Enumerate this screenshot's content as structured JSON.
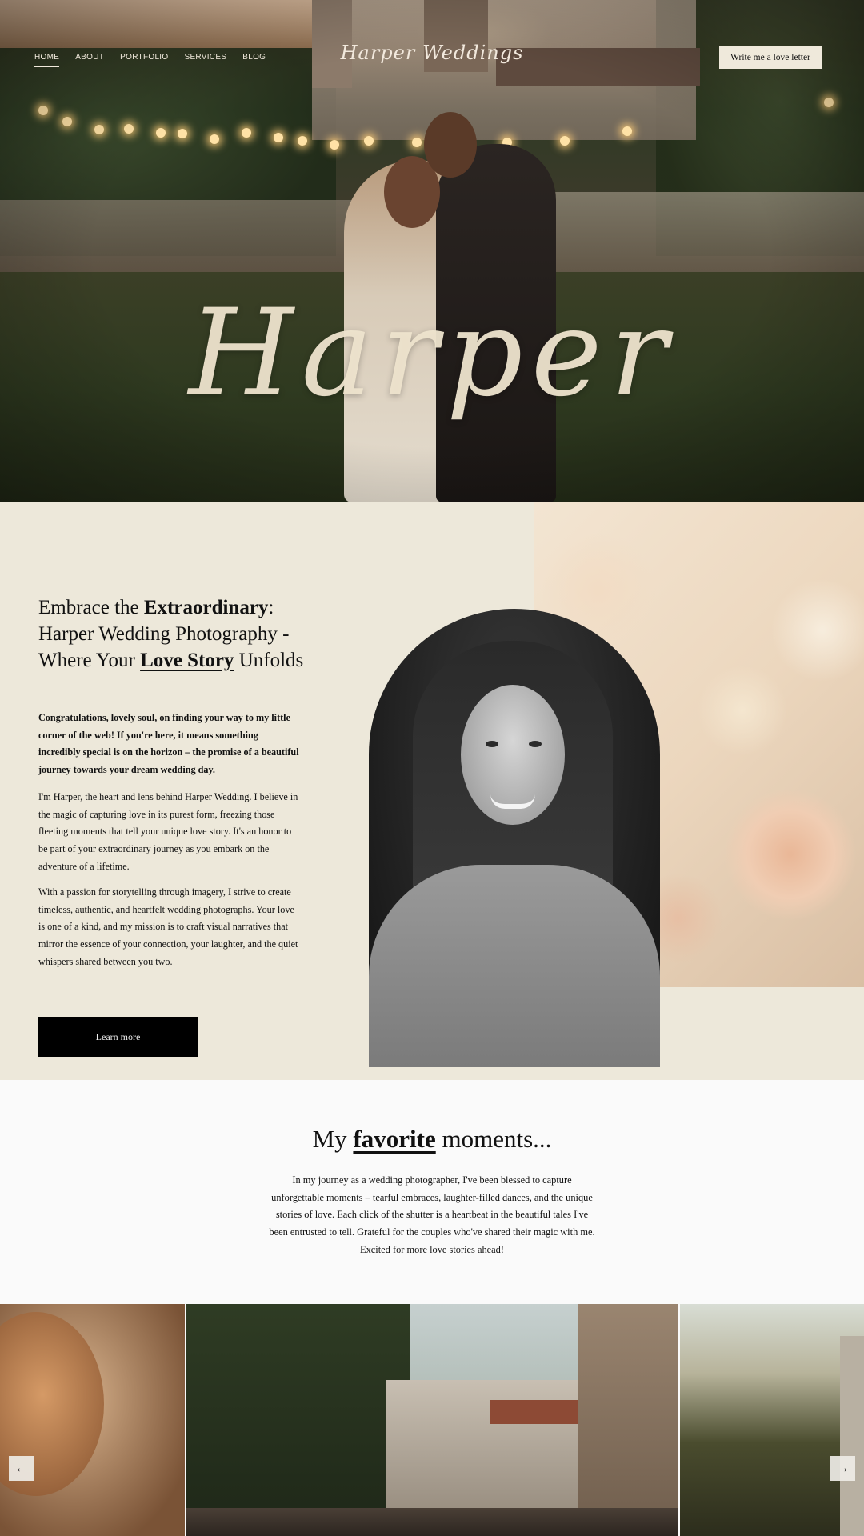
{
  "nav": {
    "items": [
      {
        "label": "HOME",
        "active": true
      },
      {
        "label": "ABOUT"
      },
      {
        "label": "PORTFOLIO"
      },
      {
        "label": "SERVICES"
      },
      {
        "label": "BLOG"
      }
    ]
  },
  "brand": "Harper Weddings",
  "header_button": "Write me a love letter",
  "hero_script": "Harper",
  "about": {
    "title_part1": "Embrace the ",
    "title_bold": "Extraordinary",
    "title_part2": ": Harper Wedding Photography - Where Your ",
    "title_underlined": "Love Story",
    "title_part3": " Unfolds",
    "lead": "Congratulations, lovely soul, on finding your way to my little corner of the web! If you're here, it means something incredibly special is on the horizon – the promise of a beautiful journey towards your dream wedding day.",
    "p1": "I'm Harper, the heart and lens behind Harper Wedding. I believe in the magic of capturing love in its purest form, freezing those fleeting moments that tell your unique love story. It's an honor to be part of your extraordinary journey as you embark on the adventure of a lifetime.",
    "p2": "With a passion for storytelling through imagery, I strive to create timeless, authentic, and heartfelt wedding photographs. Your love is one of a kind, and my mission is to craft visual narratives that mirror the essence of your connection, your laughter, and the quiet whispers shared between you two.",
    "button": "Learn more"
  },
  "moments": {
    "title_part1": "My ",
    "title_underlined": "favorite",
    "title_part2": " moments...",
    "text": "In my journey as a wedding photographer, I've been blessed to capture unforgettable moments – tearful embraces, laughter-filled dances, and the unique stories of love. Each click of the shutter is a heartbeat in the beautiful tales I've been entrusted to tell. Grateful for the couples who've shared their magic with me. Excited for more love stories ahead!"
  },
  "gallery": {
    "prev_icon": "arrow-left-icon",
    "next_icon": "arrow-right-icon",
    "prev_glyph": "←",
    "next_glyph": "→"
  }
}
